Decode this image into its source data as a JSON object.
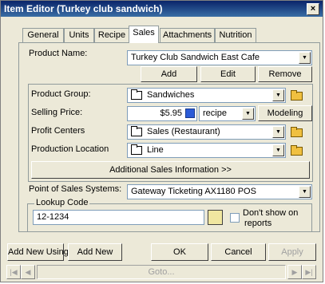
{
  "window": {
    "title": "Item Editor (Turkey club sandwich)",
    "close_label": "×"
  },
  "tabs": [
    {
      "label": "General"
    },
    {
      "label": "Units"
    },
    {
      "label": "Recipe"
    },
    {
      "label": "Sales"
    },
    {
      "label": "Attachments"
    },
    {
      "label": "Nutrition"
    }
  ],
  "product": {
    "name_label": "Product Name:",
    "name_value": "Turkey Club Sandwich East Cafe",
    "add_label": "Add",
    "edit_label": "Edit",
    "remove_label": "Remove"
  },
  "details": {
    "group_label": "Product Group:",
    "group_value": "Sandwiches",
    "price_label": "Selling Price:",
    "price_value": "$5.95",
    "price_source": "recipe",
    "modeling_label": "Modeling",
    "profit_label": "Profit Centers",
    "profit_value": "Sales (Restaurant)",
    "location_label": "Production Location",
    "location_value": "Line",
    "additional_label": "Additional Sales Information >>"
  },
  "pos": {
    "label": "Point of Sales Systems:",
    "value": "Gateway Ticketing AX1180 POS"
  },
  "lookup": {
    "legend": "Lookup Code",
    "value": "12-1234",
    "dont_show_label_line1": "Don't show on",
    "dont_show_label_line2": "reports"
  },
  "footer": {
    "add_new_using": "Add New Using",
    "add_new": "Add New",
    "ok": "OK",
    "cancel": "Cancel",
    "apply": "Apply",
    "goto": "Goto..."
  },
  "colors": {
    "title_start": "#0a246a",
    "title_end": "#3a6ea5",
    "face": "#ece9d8"
  }
}
